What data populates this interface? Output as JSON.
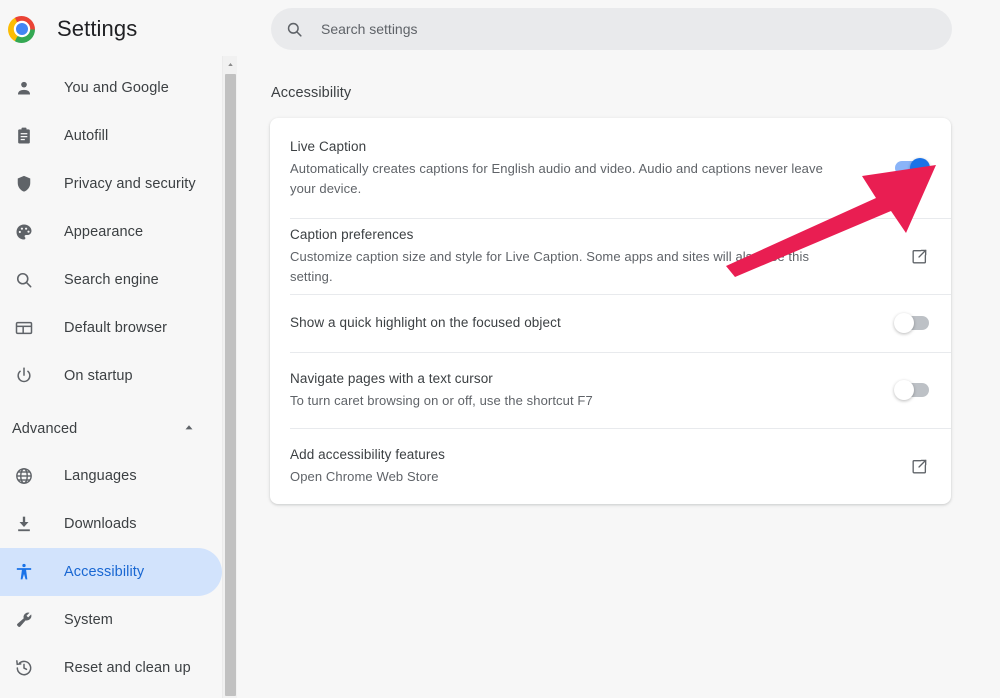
{
  "window": {
    "title": "Settings"
  },
  "sidebar": {
    "logo": "chrome-logo",
    "items": [
      {
        "label": "You and Google",
        "icon": "person-icon",
        "selected": false
      },
      {
        "label": "Autofill",
        "icon": "clipboard-icon",
        "selected": false
      },
      {
        "label": "Privacy and security",
        "icon": "shield-icon",
        "selected": false
      },
      {
        "label": "Appearance",
        "icon": "palette-icon",
        "selected": false
      },
      {
        "label": "Search engine",
        "icon": "search-icon",
        "selected": false
      },
      {
        "label": "Default browser",
        "icon": "browser-window-icon",
        "selected": false
      },
      {
        "label": "On startup",
        "icon": "power-icon",
        "selected": false
      }
    ],
    "advanced": {
      "label": "Advanced",
      "chevron": "chevron-up-icon",
      "expanded": true
    },
    "advanced_items": [
      {
        "label": "Languages",
        "icon": "globe-icon",
        "selected": false
      },
      {
        "label": "Downloads",
        "icon": "download-icon",
        "selected": false
      },
      {
        "label": "Accessibility",
        "icon": "accessibility-icon",
        "selected": true
      },
      {
        "label": "System",
        "icon": "wrench-icon",
        "selected": false
      },
      {
        "label": "Reset and clean up",
        "icon": "history-icon",
        "selected": false
      }
    ]
  },
  "search": {
    "icon": "search-icon",
    "value": "",
    "placeholder": "Search settings"
  },
  "main": {
    "page_title": "Accessibility",
    "rows": [
      {
        "title": "Live Caption",
        "subtitle": "Automatically creates captions for English audio and video. Audio and captions never leave your device.",
        "control": "toggle",
        "state": "on"
      },
      {
        "title": "Caption preferences",
        "subtitle": "Customize caption size and style for Live Caption. Some apps and sites will also use this setting.",
        "control": "external-link",
        "state": ""
      },
      {
        "title": "Show a quick highlight on the focused object",
        "subtitle": "",
        "control": "toggle",
        "state": "off"
      },
      {
        "title": "Navigate pages with a text cursor",
        "subtitle": "To turn caret browsing on or off, use the shortcut F7",
        "control": "toggle",
        "state": "off"
      },
      {
        "title": "Add accessibility features",
        "subtitle": "Open Chrome Web Store",
        "control": "external-link",
        "state": ""
      }
    ]
  },
  "annotation": {
    "type": "arrow",
    "color": "#e91e52",
    "points_to": "live-caption-toggle"
  },
  "colors": {
    "accent": "#1a73e8",
    "accent_light": "#8ab4f8",
    "selected_pill": "#d2e3fc",
    "page_bg": "#f7f7f7",
    "card_bg": "#ffffff",
    "text_primary": "#3c4043",
    "text_secondary": "#5f6368",
    "annotation": "#e91e52"
  }
}
